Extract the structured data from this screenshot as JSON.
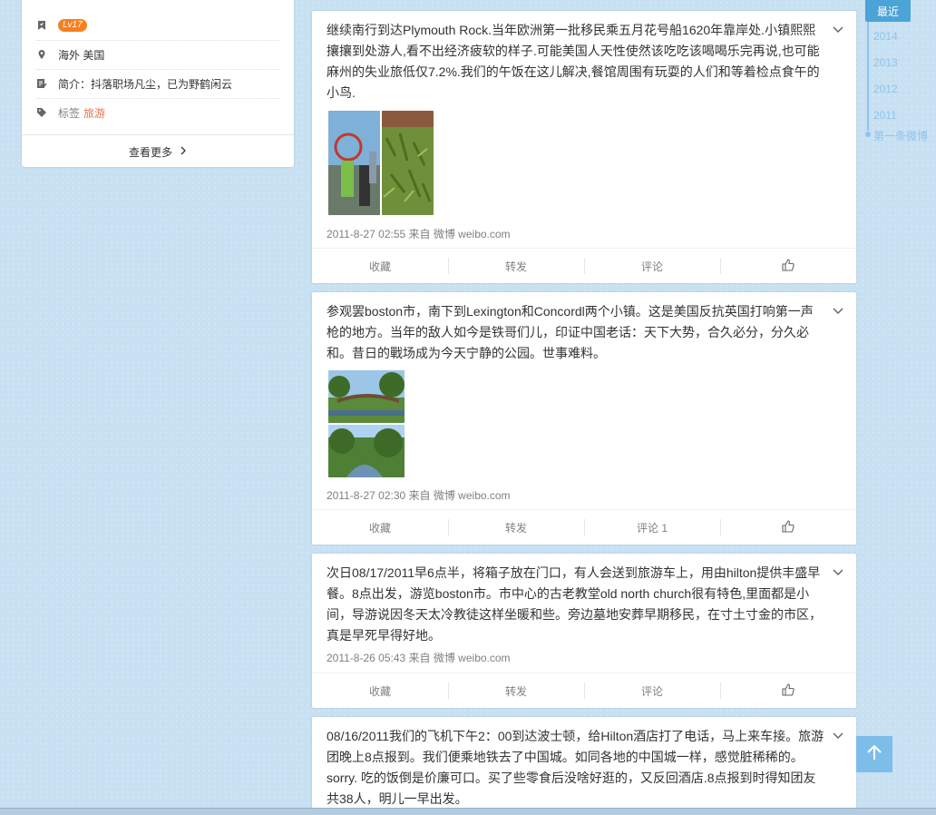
{
  "profile": {
    "level": "Lv17",
    "location": "海外 美国",
    "bio": "简介：抖落职场凡尘，已为野鹤闲云",
    "tags_label": "标签",
    "tag": "旅游",
    "see_more": "查看更多"
  },
  "timeline": {
    "current": "最近",
    "years": [
      "2014",
      "2013",
      "2012",
      "2011"
    ],
    "first": "第一条微博"
  },
  "actions": {
    "favorite": "收藏",
    "repost": "转发",
    "comment": "评论",
    "comment_with_count": "评论 1"
  },
  "posts": [
    {
      "text": "继续南行到达Plymouth Rock.当年欧洲第一批移民乘五月花号船1620年靠岸处.小镇熙熙攘攘到处游人,看不出经济疲软的样子.可能美国人天性使然该吃吃该喝喝乐完再说,也可能麻州的失业旅低仅7.2%.我们的午饭在这儿解决,餐馆周围有玩耍的人们和等着检点食午的小鸟.",
      "meta": "2011-8-27 02:55 来自 微博 weibo.com"
    },
    {
      "text": "参观罢boston市，南下到Lexington和Concordl两个小镇。这是美国反抗英国打响第一声枪的地方。当年的敌人如今是铁哥们儿，印证中国老话：天下大势，合久必分，分久必和。昔日的戰场成为今天宁静的公园。世事难料。",
      "meta": "2011-8-27 02:30 来自 微博 weibo.com"
    },
    {
      "text": "次日08/17/2011早6点半，将箱子放在门口，有人会送到旅游车上，用由hilton提供丰盛早餐。8点出发，游览boston市。市中心的古老教堂old north church很有特色,里面都是小间，导游说因冬天太冷教徒这样坐暖和些。旁边墓地安葬早期移民，在寸土寸金的市区，真是早死早得好地。",
      "meta": "2011-8-26 05:43 来自 微博 weibo.com"
    },
    {
      "text": "08/16/2011我们的飞机下午2：00到达波士顿，给Hilton酒店打了电话，马上来车接。旅游团晚上8点报到。我们便乘地铁去了中国城。如同各地的中国城一样，感觉脏稀稀的。sorry. 吃的饭倒是价廉可口。买了些零食后没啥好逛的，又反回酒店.8点报到时得知团友共38人，明儿一早出发。"
    }
  ],
  "colors": {
    "background": "#c7e0f2",
    "accent": "#4ba3d6",
    "badge": "#f7801e",
    "tag": "#eb7350"
  }
}
